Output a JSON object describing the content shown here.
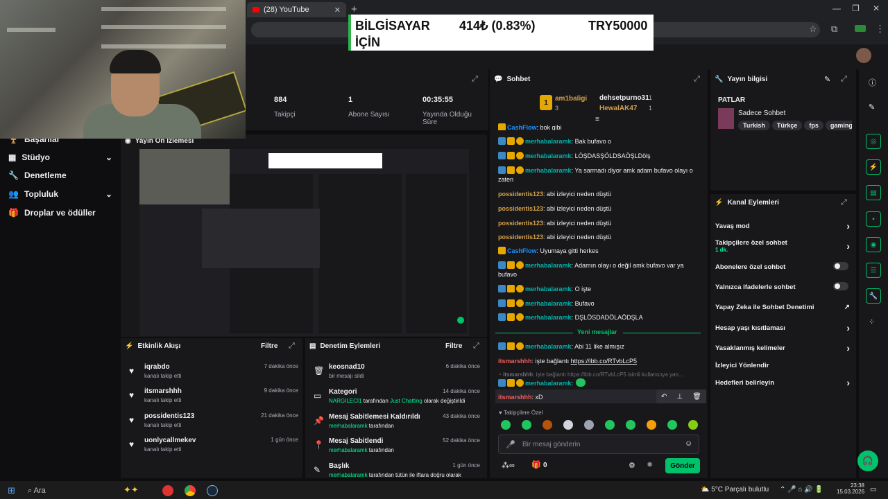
{
  "browser": {
    "tab_title": "(28) YouTube",
    "tab_close": "✕",
    "new_tab": "+",
    "minimize": "—",
    "restore": "❐",
    "close": "✕",
    "star": "☆",
    "ext": "⧉",
    "menu": "⋮"
  },
  "ticker": {
    "label_line1": "BİLGİSAYAR",
    "label_line2": "İÇİN",
    "amount": "414₺ (0.83%)",
    "goal": "TRY50000"
  },
  "stats": [
    {
      "value": "884",
      "label": "Takipçi"
    },
    {
      "value": "1",
      "label": "Abone Sayısı"
    },
    {
      "value": "00:35:55",
      "label": "Yayında Olduğu Süre"
    }
  ],
  "nav": [
    {
      "label": "Başarılar",
      "icon": "trophy-icon"
    },
    {
      "label": "Stüdyo",
      "icon": "studio-icon",
      "chevron": "⌄"
    },
    {
      "label": "Denetleme",
      "icon": "wrench-icon"
    },
    {
      "label": "Topluluk",
      "icon": "users-icon",
      "chevron": "⌄"
    },
    {
      "label": "Droplar ve ödüller",
      "icon": "gift-icon"
    }
  ],
  "preview": {
    "title": "Yayın Ön İzlemesi"
  },
  "activity": {
    "title": "Etkinlik Akışı",
    "filter": "Filtre",
    "items": [
      {
        "name": "iqrabdo",
        "sub": "kanalı takip etti",
        "time": "7 dakika önce"
      },
      {
        "name": "itsmarshhh",
        "sub": "kanalı takip etti",
        "time": "9 dakika önce"
      },
      {
        "name": "possidentis123",
        "sub": "kanalı takip etti",
        "time": "21 dakika önce"
      },
      {
        "name": "uonlycallmekev",
        "sub": "kanalı takip etti",
        "time": "1 gün önce"
      }
    ]
  },
  "moderation": {
    "title": "Denetim Eylemleri",
    "filter": "Filtre",
    "items": [
      {
        "name": "keosnad10",
        "sub_pre": "",
        "sub_hl": "",
        "sub_mid": "bir mesajı sildi",
        "sub_hl2": "",
        "sub_post": "",
        "time": "6 dakika önce"
      },
      {
        "name": "Kategori",
        "sub_pre": "",
        "sub_hl": "NARGILECI1",
        "sub_mid": " tarafından ",
        "sub_hl2": "Just Chatting",
        "sub_post": " olarak değiştirildi",
        "time": "14 dakika önce"
      },
      {
        "name": "Mesaj Sabitlemesi Kaldırıldı",
        "sub_pre": "",
        "sub_hl": "merhabalaramk",
        "sub_mid": " tarafından",
        "sub_hl2": "",
        "sub_post": "",
        "time": "43 dakika önce"
      },
      {
        "name": "Mesaj Sabitlendi",
        "sub_pre": "",
        "sub_hl": "merhabalaramk",
        "sub_mid": " tarafından",
        "sub_hl2": "",
        "sub_post": "",
        "time": "52 dakika önce"
      },
      {
        "name": "Başlık",
        "sub_pre": "",
        "sub_hl": "merhabalaramk",
        "sub_mid": " tarafından tütün ile iftara doğru olarak",
        "sub_hl2": "",
        "sub_post": "",
        "time": "1 gün önce"
      }
    ]
  },
  "chat": {
    "title": "Sohbet",
    "leaders": [
      {
        "rank": "1",
        "name": "am1baligi",
        "count": "3"
      },
      {
        "rank": "",
        "name": "dehsetpurno31",
        "count": "1"
      },
      {
        "rank": "",
        "name": "HewalAK47",
        "count": "1"
      }
    ],
    "messages": [
      {
        "user": "CashFlow",
        "text": " bok gibi"
      },
      {
        "user": "merhabalaramk",
        "text": " Bak bufavo o"
      },
      {
        "user": "merhabalaramk",
        "text": " LÖŞDASŞÖLDSAÖŞLDölş"
      },
      {
        "user": "merhabalaramk",
        "text": " Ya sarmadı diyor amk adam bufavo olayı o zaten"
      },
      {
        "user": "possidentis123",
        "text": " abi izleyici neden düştü"
      },
      {
        "user": "possidentis123",
        "text": " abi izleyici neden düştü"
      },
      {
        "user": "possidentis123",
        "text": " abi izleyici neden düştü"
      },
      {
        "user": "possidentis123",
        "text": " abi izleyici neden düştü"
      },
      {
        "user": "CashFlow",
        "text": " Uyumaya gitti herkes"
      },
      {
        "user": "merhabalaramk",
        "text": " Adamın olayı o değil amk bufavo var ya bufavo"
      },
      {
        "user": "merhabalaramk",
        "text": " O işte"
      },
      {
        "user": "merhabalaramk",
        "text": " Bufavo"
      },
      {
        "user": "merhabalaramk",
        "text": " DŞLÖSDADÖLAÖDŞLA"
      },
      {
        "user": "merhabalaramk",
        "text": " Abi 11 like almışız"
      },
      {
        "user": "itsmarshhh",
        "text": " işte bağlantı ",
        "link": "https://ibb.co/RTvbLcP5"
      },
      {
        "user": "itsmarshhh",
        "text": " işte bağlantı https://ibb.co/RTvbLcP5 isimli kullanıcıya yan..."
      },
      {
        "user": "merhabalaramk",
        "text": ""
      },
      {
        "user": "itsmarshhh",
        "text": " xD"
      }
    ],
    "new_messages": "Yeni mesajlar",
    "followers_only": "Takipçilere Özel",
    "input_placeholder": "Bir mesaj gönderin",
    "points": "0",
    "send": "Gönder"
  },
  "stream_info": {
    "title": "Yayın bilgisi",
    "stream_title": "PATLAR",
    "category": "Sadece Sohbet",
    "tags": [
      "Turkish",
      "Türkçe",
      "fps",
      "gaming"
    ]
  },
  "channel_actions": {
    "title": "Kanal Eylemleri",
    "items": [
      {
        "label": "Yavaş mod",
        "type": "arrow"
      },
      {
        "label": "Takipçilere özel sohbet",
        "sub": "1 dk.",
        "type": "arrow"
      },
      {
        "label": "Abonelere özel sohbet",
        "type": "toggle"
      },
      {
        "label": "Yalnızca ifadelerle sohbet",
        "type": "toggle"
      },
      {
        "label": "Yapay Zeka ile Sohbet Denetimi",
        "type": "external"
      },
      {
        "label": "Hesap yaşı kısıtlaması",
        "type": "arrow"
      },
      {
        "label": "Yasaklanmış kelimeler",
        "type": "arrow"
      },
      {
        "label": "İzleyici Yönlendir",
        "type": "none"
      },
      {
        "label": "Hedefleri belirleyin",
        "type": "arrow"
      }
    ]
  },
  "taskbar": {
    "search": "Ara",
    "weather": "5°C  Parçalı bulutlu",
    "time": "23:38",
    "date": "15.03.2026"
  },
  "colors": {
    "accent": "#00c26b",
    "bg": "#0e0e10",
    "panel": "#18181b"
  }
}
